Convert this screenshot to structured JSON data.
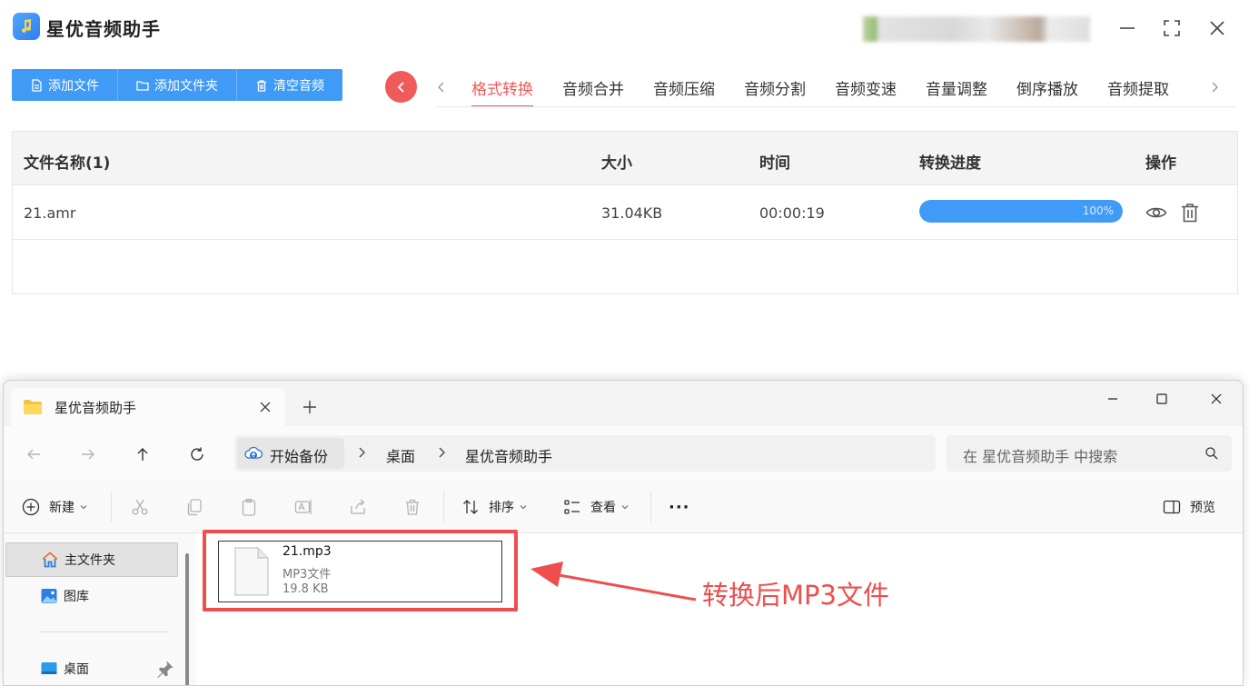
{
  "app": {
    "title": "星优音频助手",
    "toolbar": {
      "add_file": "添加文件",
      "add_folder": "添加文件夹",
      "clear_audio": "清空音频"
    },
    "tabs": [
      "格式转换",
      "音频合并",
      "音频压缩",
      "音频分割",
      "音频变速",
      "音量调整",
      "倒序播放",
      "音频提取"
    ],
    "active_tab": "格式转换",
    "table": {
      "headers": {
        "name": "文件名称(1)",
        "size": "大小",
        "time": "时间",
        "progress": "转换进度",
        "ops": "操作"
      },
      "rows": [
        {
          "name": "21.amr",
          "size": "31.04KB",
          "time": "00:00:19",
          "progress_label": "100%",
          "progress": 1.0
        }
      ]
    }
  },
  "explorer": {
    "tab_title": "星优音频助手",
    "breadcrumb": {
      "root": "开始备份",
      "path": [
        "桌面",
        "星优音频助手"
      ]
    },
    "search_placeholder": "在 星优音频助手 中搜索",
    "commands": {
      "new": "新建",
      "sort": "排序",
      "view": "查看",
      "more": "···",
      "preview": "预览"
    },
    "sidebar": [
      {
        "label": "主文件夹",
        "icon": "home-icon",
        "selected": true
      },
      {
        "label": "图库",
        "icon": "gallery-icon",
        "selected": false
      },
      {
        "label": "桌面",
        "icon": "desktop-icon",
        "selected": false,
        "pinned": true
      }
    ],
    "files": [
      {
        "name": "21.mp3",
        "type": "MP3文件",
        "size": "19.8 KB"
      }
    ]
  },
  "annotation": {
    "text": "转换后MP3文件",
    "color": "#ee4e4e"
  },
  "colors": {
    "primary_blue": "#3f9bf5",
    "accent_red": "#f05a5a"
  }
}
